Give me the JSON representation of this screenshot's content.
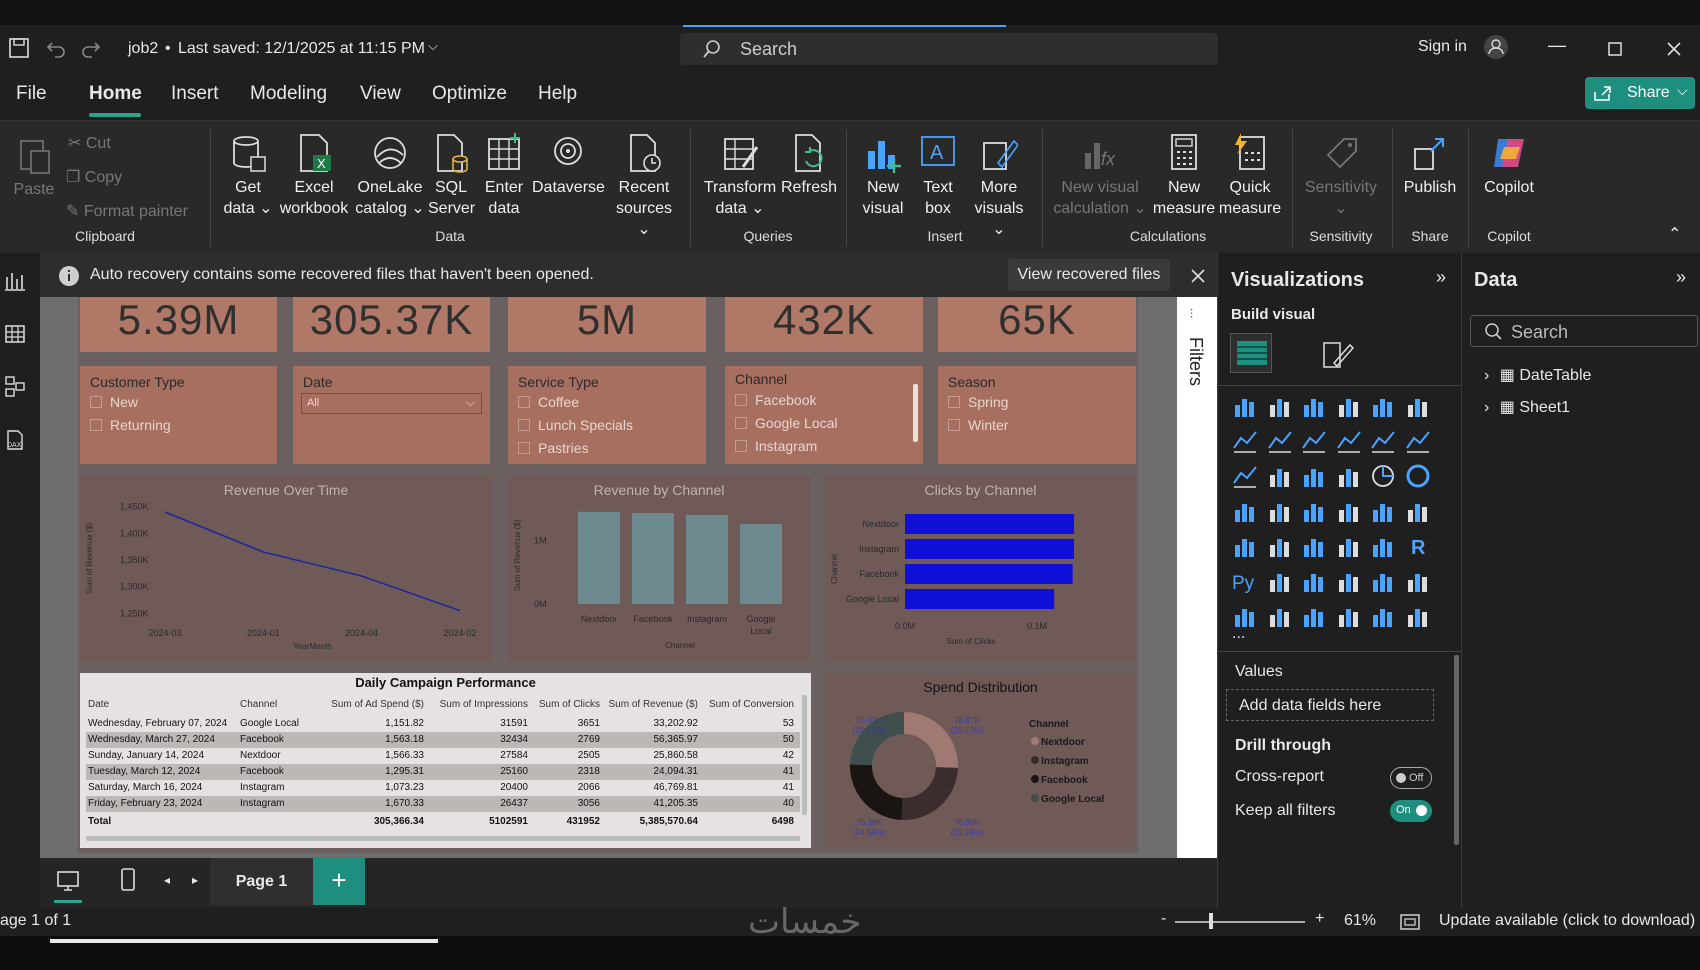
{
  "app": {
    "doc_title": "job2",
    "saved_text": "Last saved: 12/1/2025 at 11:15 PM",
    "search": "Search",
    "sign_in": "Sign in"
  },
  "menu": {
    "tabs": [
      "File",
      "Home",
      "Insert",
      "Modeling",
      "View",
      "Optimize",
      "Help"
    ],
    "share": "Share"
  },
  "ribbon": {
    "clipboard": {
      "paste": "Paste",
      "cut": "Cut",
      "copy": "Copy",
      "format_painter": "Format painter",
      "group": "Clipboard"
    },
    "data": {
      "get_data": [
        "Get",
        "data ⌄"
      ],
      "excel": [
        "Excel",
        "workbook"
      ],
      "onelake": [
        "OneLake",
        "catalog ⌄"
      ],
      "sql": [
        "SQL",
        "Server"
      ],
      "enter": [
        "Enter",
        "data"
      ],
      "dataverse": "Dataverse",
      "recent": [
        "Recent",
        "sources ⌄"
      ],
      "group": "Data"
    },
    "queries": {
      "transform": [
        "Transform",
        "data ⌄"
      ],
      "refresh": "Refresh",
      "group": "Queries"
    },
    "insert": {
      "new_visual": [
        "New",
        "visual"
      ],
      "text_box": [
        "Text",
        "box"
      ],
      "more": [
        "More",
        "visuals ⌄"
      ],
      "group": "Insert"
    },
    "calc": {
      "new_visual_calc": [
        "New visual",
        "calculation ⌄"
      ],
      "new_measure": [
        "New",
        "measure"
      ],
      "quick_measure": [
        "Quick",
        "measure"
      ],
      "group": "Calculations"
    },
    "sensitivity": {
      "label": [
        "Sensitivity",
        "⌄"
      ],
      "group": "Sensitivity"
    },
    "share": {
      "publish": "Publish",
      "group": "Share"
    },
    "copilot": {
      "label": "Copilot",
      "group": "Copilot"
    }
  },
  "notification": {
    "text": "Auto recovery contains some recovered files that haven't been opened.",
    "button": "View recovered files"
  },
  "kpis": [
    "5.39M",
    "305.37K",
    "5M",
    "432K",
    "65K"
  ],
  "slicers": [
    {
      "title": "Customer Type",
      "items": [
        "New",
        "Returning"
      ]
    },
    {
      "title": "Date",
      "dropdown": "All"
    },
    {
      "title": "Service Type",
      "items": [
        "Coffee",
        "Lunch Specials",
        "Pastries"
      ]
    },
    {
      "title": "Channel",
      "items": [
        "Facebook",
        "Google Local",
        "Instagram"
      ]
    },
    {
      "title": "Season",
      "items": [
        "Spring",
        "Winter"
      ]
    }
  ],
  "chart_data": [
    {
      "type": "line",
      "title": "Revenue Over Time",
      "xlabel": "YearMonth",
      "ylabel": "Sum of Revenue ($)",
      "x": [
        "2024-03",
        "2024-01",
        "2024-04",
        "2024-02"
      ],
      "y": [
        1440000,
        1365000,
        1320000,
        1255000
      ],
      "yticks": [
        "1,250K",
        "1,300K",
        "1,350K",
        "1,400K",
        "1,450K"
      ],
      "ylim": [
        1245000,
        1455000
      ],
      "color": "#1c2a9a"
    },
    {
      "type": "bar",
      "title": "Revenue by Channel",
      "xlabel": "Channel",
      "ylabel": "Sum of Revenue ($)",
      "categories": [
        "Nextdoor",
        "Facebook",
        "Instagram",
        "Google Local"
      ],
      "values": [
        1450000,
        1430000,
        1400000,
        1260000
      ],
      "yticks": [
        "0M",
        "1M"
      ],
      "ylim": [
        0,
        1700000
      ],
      "color": "#6d8a90"
    },
    {
      "type": "bar",
      "orientation": "horizontal",
      "title": "Clicks by Channel",
      "xlabel": "Sum of Clicks",
      "ylabel": "Channel",
      "categories": [
        "Nextdoor",
        "Instagram",
        "Facebook",
        "Google Local"
      ],
      "values": [
        0.128,
        0.128,
        0.127,
        0.113
      ],
      "xticks": [
        "0.0M",
        "0.1M"
      ],
      "xlim": [
        0,
        0.14
      ],
      "color": "#1010d8"
    },
    {
      "type": "pie",
      "title": "Spend Distribution",
      "legend_title": "Channel",
      "labels": [
        "Nextdoor",
        "Instagram",
        "Facebook",
        "Google Local"
      ],
      "values": [
        78.07,
        76.89,
        75.38,
        75.03
      ],
      "pct": [
        "25.57%",
        "25.18%",
        "24.68%",
        "24.57%"
      ],
      "value_labels": [
        "78.07K",
        "76.89K",
        "75.38K",
        "75.03K"
      ],
      "colors": [
        "#a07a72",
        "#3a2d2b",
        "#1a1412",
        "#3f4f4d"
      ]
    }
  ],
  "table": {
    "title": "Daily Campaign Performance",
    "headers": [
      "Date",
      "Channel",
      "Sum of Ad Spend ($)",
      "Sum of Impressions",
      "Sum of Clicks",
      "Sum of Revenue ($)",
      "Sum of Conversion"
    ],
    "rows": [
      [
        "Wednesday, February 07, 2024",
        "Google Local",
        "1,151.82",
        "31591",
        "3651",
        "33,202.92",
        "53"
      ],
      [
        "Wednesday, March 27, 2024",
        "Facebook",
        "1,563.18",
        "32434",
        "2769",
        "56,365.97",
        "50"
      ],
      [
        "Sunday, January 14, 2024",
        "Nextdoor",
        "1,566.33",
        "27584",
        "2505",
        "25,860.58",
        "42"
      ],
      [
        "Tuesday, March 12, 2024",
        "Facebook",
        "1,295.31",
        "25160",
        "2318",
        "24,094.31",
        "41"
      ],
      [
        "Saturday, March 16, 2024",
        "Instagram",
        "1,073.23",
        "20400",
        "2066",
        "46,769.81",
        "41"
      ],
      [
        "Friday, February 23, 2024",
        "Instagram",
        "1,670.33",
        "26437",
        "3056",
        "41,205.35",
        "40"
      ]
    ],
    "total": [
      "Total",
      "",
      "305,366.34",
      "5102591",
      "431952",
      "5,385,570.64",
      "6498"
    ]
  },
  "filters_label": "Filters",
  "viz": {
    "title": "Visualizations",
    "build": "Build visual",
    "values": "Values",
    "add_fields": "Add data fields here",
    "drill": "Drill through",
    "cross": "Cross-report",
    "cross_state": "Off",
    "keep": "Keep all filters",
    "keep_state": "On",
    "more": "..."
  },
  "data_pane": {
    "title": "Data",
    "search": "Search",
    "tables": [
      "DateTable",
      "Sheet1"
    ]
  },
  "pages": {
    "tab": "Page 1",
    "add": "+"
  },
  "status": {
    "page": "age 1 of 1",
    "zoom": "61%",
    "zoom_minus": "-",
    "zoom_plus": "+",
    "update": "Update available (click to download)",
    "watermark": "خمسات"
  },
  "colors": {
    "accent": "#1e8f7e",
    "canvas": "#6e6e6e",
    "card": "#b07866"
  }
}
